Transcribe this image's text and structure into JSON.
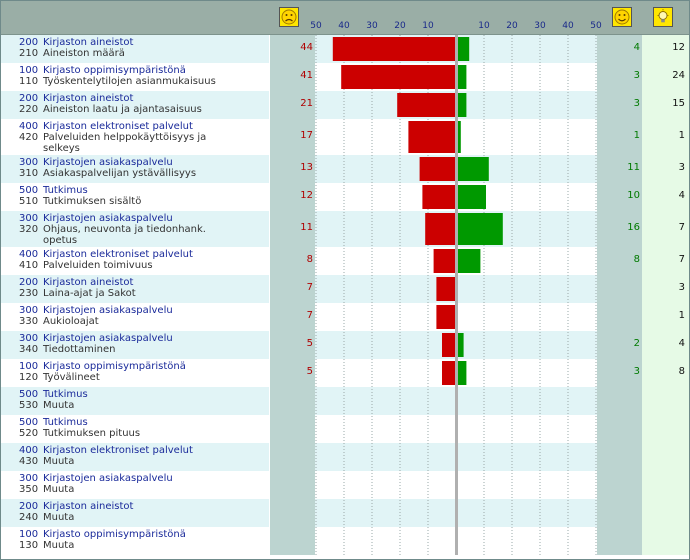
{
  "header": {
    "icons": [
      "sad-face-icon",
      "happy-face-icon",
      "lightbulb-icon"
    ],
    "neg_ticks": [
      "50",
      "40",
      "30",
      "20",
      "10"
    ],
    "pos_ticks": [
      "10",
      "20",
      "30",
      "40",
      "50"
    ]
  },
  "colors": {
    "negative": "#cc0000",
    "positive": "#009900"
  },
  "chart_data": {
    "type": "bar",
    "title": "",
    "xlabel": "",
    "ylabel": "",
    "xlim_negative": [
      0,
      50
    ],
    "xlim_positive": [
      0,
      50
    ],
    "grid": true,
    "legend": "none",
    "rows": [
      {
        "code1": "200",
        "cat": "Kirjaston aineistot",
        "code2": "210",
        "sub": "Aineiston määrä",
        "neg": 44,
        "pos": 4,
        "total": 12
      },
      {
        "code1": "100",
        "cat": "Kirjasto oppimisympäristönä",
        "code2": "110",
        "sub": "Työskentelytilojen asianmukaisuus",
        "neg": 41,
        "pos": 3,
        "total": 24
      },
      {
        "code1": "200",
        "cat": "Kirjaston aineistot",
        "code2": "220",
        "sub": "Aineiston laatu ja ajantasaisuus",
        "neg": 21,
        "pos": 3,
        "total": 15
      },
      {
        "code1": "400",
        "cat": "Kirjaston elektroniset palvelut",
        "code2": "420",
        "sub": "Palveluiden helppokäyttöisyys ja",
        "sub2": "selkeys",
        "neg": 17,
        "pos": 1,
        "total": 1
      },
      {
        "code1": "300",
        "cat": "Kirjastojen asiakaspalvelu",
        "code2": "310",
        "sub": "Asiakaspalvelijan ystävällisyys",
        "neg": 13,
        "pos": 11,
        "total": 3
      },
      {
        "code1": "500",
        "cat": "Tutkimus",
        "code2": "510",
        "sub": "Tutkimuksen sisältö",
        "neg": 12,
        "pos": 10,
        "total": 4
      },
      {
        "code1": "300",
        "cat": "Kirjastojen asiakaspalvelu",
        "code2": "320",
        "sub": "Ohjaus, neuvonta ja tiedonhank.",
        "sub2": "opetus",
        "neg": 11,
        "pos": 16,
        "total": 7
      },
      {
        "code1": "400",
        "cat": "Kirjaston elektroniset palvelut",
        "code2": "410",
        "sub": "Palveluiden toimivuus",
        "neg": 8,
        "pos": 8,
        "total": 7
      },
      {
        "code1": "200",
        "cat": "Kirjaston aineistot",
        "code2": "230",
        "sub": "Laina-ajat ja Sakot",
        "neg": 7,
        "pos": null,
        "total": 3
      },
      {
        "code1": "300",
        "cat": "Kirjastojen asiakaspalvelu",
        "code2": "330",
        "sub": "Aukioloajat",
        "neg": 7,
        "pos": null,
        "total": 1
      },
      {
        "code1": "300",
        "cat": "Kirjastojen asiakaspalvelu",
        "code2": "340",
        "sub": "Tiedottaminen",
        "neg": 5,
        "pos": 2,
        "total": 4
      },
      {
        "code1": "100",
        "cat": "Kirjasto oppimisympäristönä",
        "code2": "120",
        "sub": "Työvälineet",
        "neg": 5,
        "pos": 3,
        "total": 8
      },
      {
        "code1": "500",
        "cat": "Tutkimus",
        "code2": "530",
        "sub": "Muuta",
        "neg": null,
        "pos": null,
        "total": null
      },
      {
        "code1": "500",
        "cat": "Tutkimus",
        "code2": "520",
        "sub": "Tutkimuksen pituus",
        "neg": null,
        "pos": null,
        "total": null
      },
      {
        "code1": "400",
        "cat": "Kirjaston elektroniset palvelut",
        "code2": "430",
        "sub": "Muuta",
        "neg": null,
        "pos": null,
        "total": null
      },
      {
        "code1": "300",
        "cat": "Kirjastojen asiakaspalvelu",
        "code2": "350",
        "sub": "Muuta",
        "neg": null,
        "pos": null,
        "total": null
      },
      {
        "code1": "200",
        "cat": "Kirjaston aineistot",
        "code2": "240",
        "sub": "Muuta",
        "neg": null,
        "pos": null,
        "total": null
      },
      {
        "code1": "100",
        "cat": "Kirjasto oppimisympäristönä",
        "code2": "130",
        "sub": "Muuta",
        "neg": null,
        "pos": null,
        "total": null
      }
    ]
  }
}
